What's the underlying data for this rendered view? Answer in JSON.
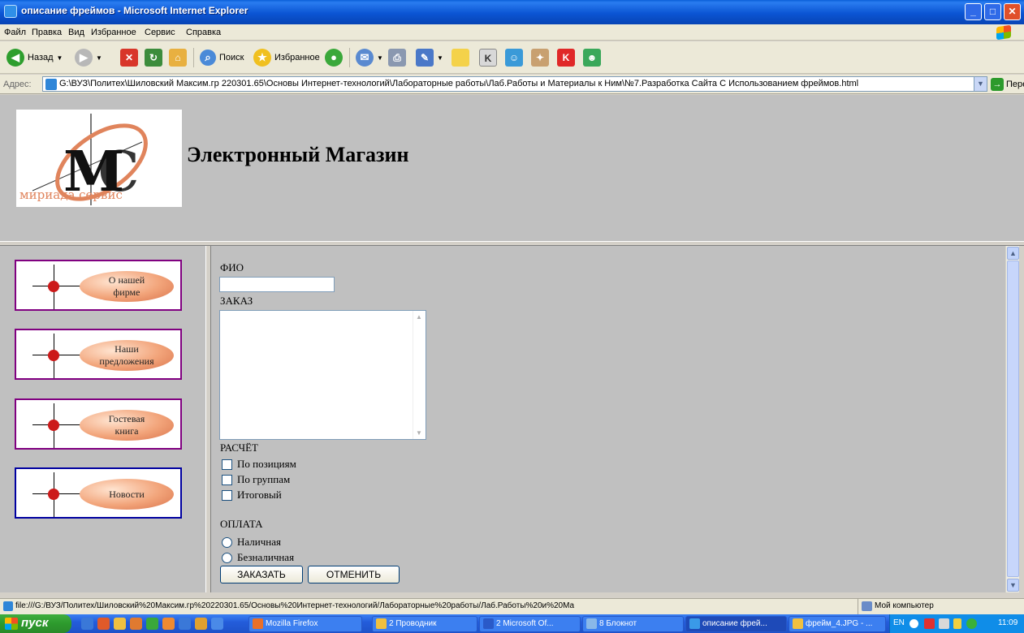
{
  "window": {
    "title": "описание фреймов - Microsoft Internet Explorer"
  },
  "menu": [
    "Файл",
    "Правка",
    "Вид",
    "Избранное",
    "Сервис",
    "Справка"
  ],
  "toolbar": {
    "back_label": "Назад",
    "search_label": "Поиск",
    "favorites_label": "Избранное"
  },
  "address": {
    "label": "Адрес:",
    "value": "G:\\ВУЗ\\Политех\\Шиловский Максим.гр 220301.65\\Основы Интернет-технологий\\Лабораторные работы\\Лаб.Работы и Материалы к Ним\\№7.Разработка Сайта С Использованием фреймов.html",
    "go_label": "Переход"
  },
  "header": {
    "logo_text": "мириада сервис",
    "title": "Электронный Магазин"
  },
  "nav": {
    "items": [
      {
        "line1": "О нашей",
        "line2": "фирме"
      },
      {
        "line1": "Наши",
        "line2": "предложения"
      },
      {
        "line1": "Гостевая",
        "line2": "книга"
      },
      {
        "line1": "Новости",
        "line2": ""
      }
    ]
  },
  "form": {
    "fio_label": "ФИО",
    "fio_value": "",
    "order_label": "ЗАКАЗ",
    "order_value": "",
    "calc_label": "РАСЧЁТ",
    "calc_options": [
      "По позициям",
      "По группам",
      "Итоговый"
    ],
    "pay_label": "ОПЛАТА",
    "pay_options": [
      "Наличная",
      "Безналичная"
    ],
    "submit_label": "ЗАКАЗАТЬ",
    "cancel_label": "ОТМЕНИТЬ"
  },
  "status": {
    "text": "file:///G:/ВУЗ/Политех/Шиловский%20Максим.гр%20220301.65/Основы%20Интернет-технологий/Лабораторные%20работы/Лаб.Работы%20и%20Ма",
    "zone": "Мой компьютер"
  },
  "taskbar": {
    "start_label": "пуск",
    "tasks": [
      "Mozilla Firefox",
      "2 Проводник",
      "2 Microsoft Of...",
      "8 Блокнот",
      "описание фрей...",
      "фрейм_4.JPG - ..."
    ],
    "lang": "EN",
    "clock": "11:09"
  },
  "colors": {
    "page_bg": "#c0c0c0",
    "nav_border_purple": "#800080",
    "nav_border_blue": "#0000a0",
    "pill_orange": "#f2a47a"
  }
}
